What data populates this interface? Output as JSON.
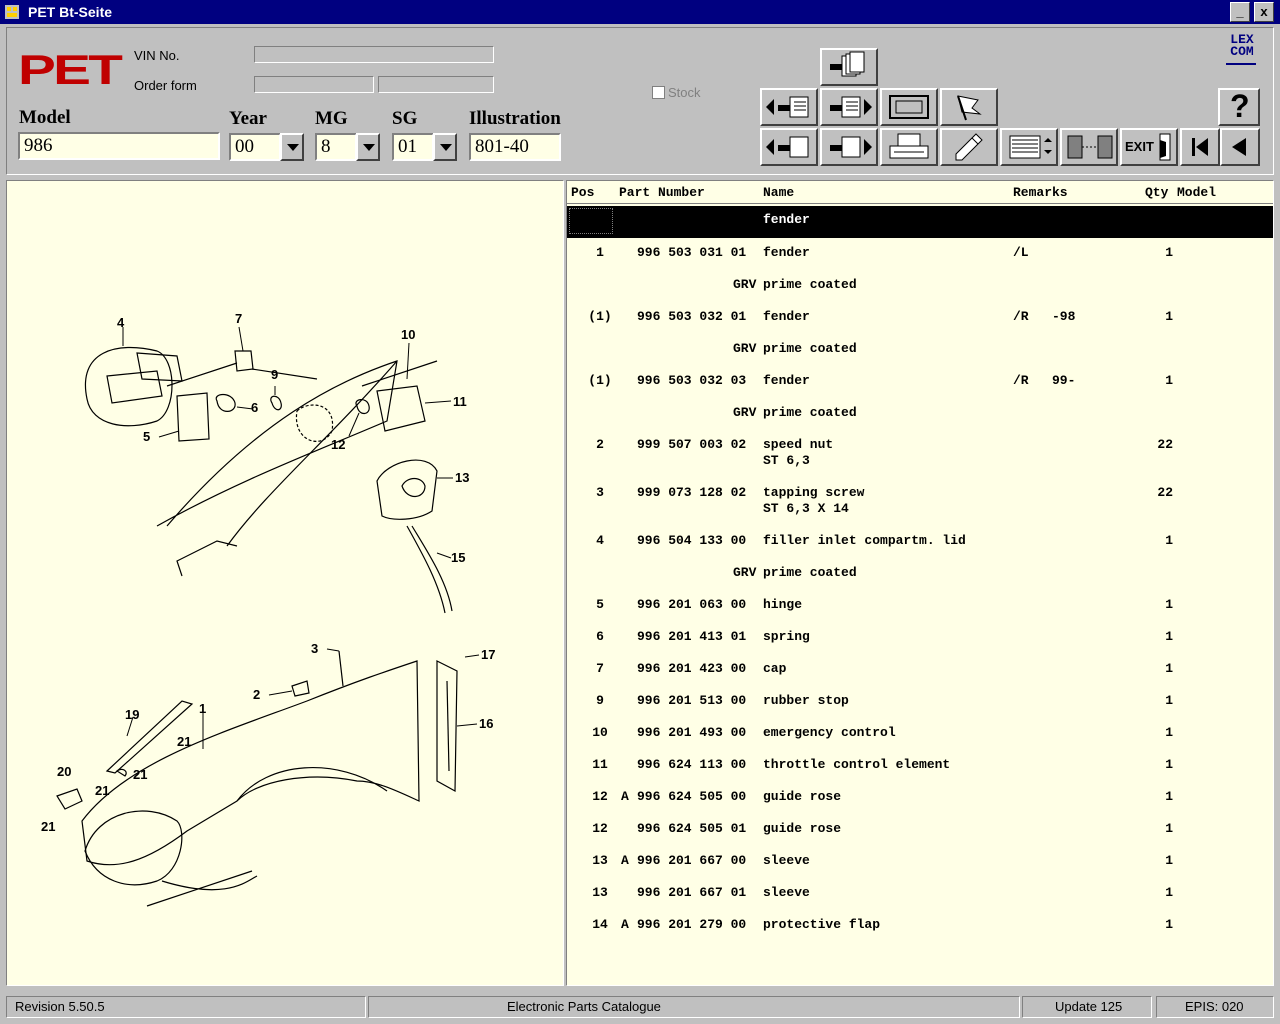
{
  "window": {
    "title": "PET Bt-Seite",
    "min_label": "_",
    "close_label": "x"
  },
  "header": {
    "logo": "PET",
    "vin_label": "VIN No.",
    "order_label": "Order form",
    "model_label": "Model",
    "model_value": "986",
    "year_label": "Year",
    "year_value": "00",
    "mg_label": "MG",
    "mg_value": "8",
    "sg_label": "SG",
    "sg_value": "01",
    "illustration_label": "Illustration",
    "illustration_value": "801-40",
    "stock_label": "Stock",
    "lexcom_line1": "LEX",
    "lexcom_line2": "COM",
    "help_label": "?",
    "exit_label": "EXIT"
  },
  "columns": {
    "pos": "Pos",
    "part": "Part Number",
    "name": "Name",
    "remarks": "Remarks",
    "qty": "Qty",
    "model": "Model"
  },
  "selected_row": {
    "name": "fender"
  },
  "rows": [
    {
      "pos": "1",
      "prefix": "",
      "part": "996 503 031 01",
      "name": "fender",
      "remarks": "/L",
      "qty": "1"
    },
    {
      "pos": "",
      "prefix": "",
      "part": "GRV",
      "name": "prime coated",
      "remarks": "",
      "qty": "",
      "note": true
    },
    {
      "pos": "(1)",
      "prefix": "",
      "part": "996 503 032 01",
      "name": "fender",
      "remarks": "/R   -98",
      "qty": "1"
    },
    {
      "pos": "",
      "prefix": "",
      "part": "GRV",
      "name": "prime coated",
      "remarks": "",
      "qty": "",
      "note": true
    },
    {
      "pos": "(1)",
      "prefix": "",
      "part": "996 503 032 03",
      "name": "fender",
      "remarks": "/R   99-",
      "qty": "1"
    },
    {
      "pos": "",
      "prefix": "",
      "part": "GRV",
      "name": "prime coated",
      "remarks": "",
      "qty": "",
      "note": true
    },
    {
      "pos": "2",
      "prefix": "",
      "part": "999 507 003 02",
      "name": "speed nut",
      "name2": "ST 6,3",
      "remarks": "",
      "qty": "22"
    },
    {
      "pos": "3",
      "prefix": "",
      "part": "999 073 128 02",
      "name": "tapping screw",
      "name2": "ST 6,3 X 14",
      "remarks": "",
      "qty": "22"
    },
    {
      "pos": "4",
      "prefix": "",
      "part": "996 504 133 00",
      "name": "filler inlet compartm. lid",
      "remarks": "",
      "qty": "1"
    },
    {
      "pos": "",
      "prefix": "",
      "part": "GRV",
      "name": "prime coated",
      "remarks": "",
      "qty": "",
      "note": true
    },
    {
      "pos": "5",
      "prefix": "",
      "part": "996 201 063 00",
      "name": "hinge",
      "remarks": "",
      "qty": "1"
    },
    {
      "pos": "6",
      "prefix": "",
      "part": "996 201 413 01",
      "name": "spring",
      "remarks": "",
      "qty": "1"
    },
    {
      "pos": "7",
      "prefix": "",
      "part": "996 201 423 00",
      "name": "cap",
      "remarks": "",
      "qty": "1"
    },
    {
      "pos": "9",
      "prefix": "",
      "part": "996 201 513 00",
      "name": "rubber stop",
      "remarks": "",
      "qty": "1"
    },
    {
      "pos": "10",
      "prefix": "",
      "part": "996 201 493 00",
      "name": "emergency control",
      "remarks": "",
      "qty": "1"
    },
    {
      "pos": "11",
      "prefix": "",
      "part": "996 624 113 00",
      "name": "throttle control element",
      "remarks": "",
      "qty": "1"
    },
    {
      "pos": "12",
      "prefix": "A",
      "part": "996 624 505 00",
      "name": "guide rose",
      "remarks": "",
      "qty": "1"
    },
    {
      "pos": "12",
      "prefix": "",
      "part": "996 624 505 01",
      "name": "guide rose",
      "remarks": "",
      "qty": "1"
    },
    {
      "pos": "13",
      "prefix": "A",
      "part": "996 201 667 00",
      "name": "sleeve",
      "remarks": "",
      "qty": "1"
    },
    {
      "pos": "13",
      "prefix": "",
      "part": "996 201 667 01",
      "name": "sleeve",
      "remarks": "",
      "qty": "1"
    },
    {
      "pos": "14",
      "prefix": "A",
      "part": "996 201 279 00",
      "name": "protective flap",
      "remarks": "",
      "qty": "1"
    }
  ],
  "illustration_callouts": [
    "4",
    "7",
    "10",
    "9",
    "6",
    "11",
    "5",
    "12",
    "13",
    "15",
    "3",
    "17",
    "2",
    "1",
    "19",
    "16",
    "21",
    "21",
    "20",
    "21",
    "21"
  ],
  "status": {
    "revision": "Revision 5.50.5",
    "catalogue": "Electronic Parts Catalogue",
    "update": "Update 125",
    "epis": "EPIS: 020"
  }
}
